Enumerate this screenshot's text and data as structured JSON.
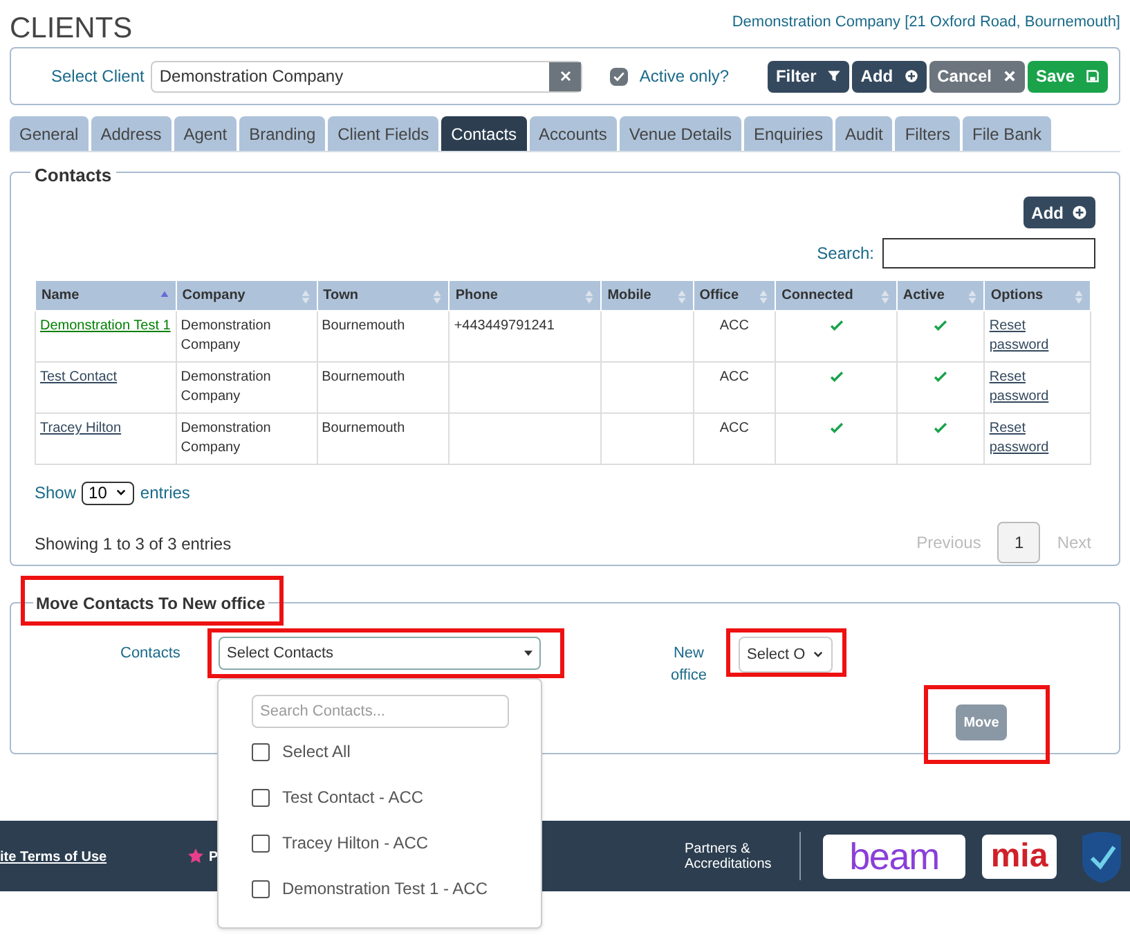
{
  "page_title": "CLIENTS",
  "client_link": "Demonstration Company [21 Oxford Road, Bournemouth]",
  "toolbar": {
    "label": "Select Client",
    "value": "Demonstration Company",
    "active_only": {
      "label": "Active only?",
      "checked": true
    },
    "buttons": [
      {
        "label": "Filter",
        "kind": "filter"
      },
      {
        "label": "Add",
        "kind": "add"
      },
      {
        "label": "Cancel",
        "kind": "cancel"
      },
      {
        "label": "Save",
        "kind": "save"
      }
    ]
  },
  "tabs": [
    {
      "label": "General",
      "selected": false
    },
    {
      "label": "Address",
      "selected": false
    },
    {
      "label": "Agent",
      "selected": false
    },
    {
      "label": "Branding",
      "selected": false
    },
    {
      "label": "Client Fields",
      "selected": false
    },
    {
      "label": "Contacts",
      "selected": true
    },
    {
      "label": "Accounts",
      "selected": false
    },
    {
      "label": "Venue Details",
      "selected": false
    },
    {
      "label": "Enquiries",
      "selected": false
    },
    {
      "label": "Audit",
      "selected": false
    },
    {
      "label": "Filters",
      "selected": false
    },
    {
      "label": "File Bank",
      "selected": false
    }
  ],
  "contacts": {
    "legend": "Contacts",
    "add_button": "Add",
    "search_label": "Search:",
    "columns": [
      {
        "label": "Name",
        "sorted": true
      },
      {
        "label": "Company",
        "sorted": false
      },
      {
        "label": "Town",
        "sorted": false
      },
      {
        "label": "Phone",
        "sorted": false
      },
      {
        "label": "Mobile",
        "sorted": false
      },
      {
        "label": "Office",
        "sorted": false
      },
      {
        "label": "Connected",
        "sorted": false
      },
      {
        "label": "Active",
        "sorted": false
      },
      {
        "label": "Options",
        "sorted": false
      }
    ],
    "rows": [
      {
        "name": "Demonstration Test 1",
        "visited": true,
        "company": "Demonstration Company",
        "town": "Bournemouth",
        "phone": "+443449791241",
        "office": "ACC",
        "connected": true,
        "active": true,
        "option": "Reset password"
      },
      {
        "name": "Test Contact",
        "visited": false,
        "company": "Demonstration Company",
        "town": "Bournemouth",
        "office": "ACC",
        "connected": true,
        "active": true,
        "option": "Reset password"
      },
      {
        "name": "Tracey Hilton",
        "visited": false,
        "company": "Demonstration Company",
        "town": "Bournemouth",
        "office": "ACC",
        "connected": true,
        "active": true,
        "option": "Reset password"
      }
    ],
    "show_label": "Show",
    "page_size": "10",
    "entries_label": "entries",
    "info": "Showing 1 to 3 of 3 entries",
    "pagination": [
      {
        "label": "Previous",
        "selected": false,
        "disabled": true
      },
      {
        "label": "1",
        "selected": true,
        "disabled": false
      },
      {
        "label": "Next",
        "selected": false,
        "disabled": true
      }
    ]
  },
  "move": {
    "legend": "Move Contacts To New office",
    "legend_highlighted": true,
    "contacts_label": "Contacts",
    "contacts_select": "Select Contacts",
    "contacts_highlighted": true,
    "office_label": "New office",
    "office_select": "Select O",
    "office_highlighted": true,
    "move_button": "Move",
    "move_highlighted": true,
    "dropdown": {
      "placeholder": "Search Contacts...",
      "options": [
        {
          "label": "Select All",
          "checked": false
        },
        {
          "label": "Test Contact - ACC",
          "checked": false
        },
        {
          "label": "Tracey Hilton - ACC",
          "checked": false
        },
        {
          "label": "Demonstration Test 1 - ACC",
          "checked": false
        }
      ]
    }
  },
  "footer": {
    "terms_link": "ite Terms of Use",
    "cut_text": "P",
    "partners_label": "Partners & Accreditations",
    "logos": [
      "beam",
      "mia"
    ]
  }
}
